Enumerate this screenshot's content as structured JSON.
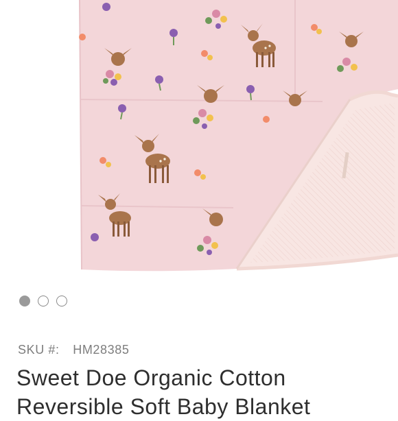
{
  "product": {
    "image_alt": "Pink fawn print quilted baby blanket with corner folded over",
    "sku_label": "SKU #:",
    "sku_value": "HM28385",
    "title": "Sweet Doe Organic Cotton Reversible Soft Baby Blanket"
  },
  "carousel": {
    "slides": 3,
    "active_index": 0
  },
  "colors": {
    "blanket_pink": "#f3d6d9",
    "reverse_pink": "#f8e6e3",
    "fawn_brown": "#9b6a45",
    "dot_active": "#9a9a9a",
    "title_text": "#2e2e2e",
    "sku_text": "#7d7d7d"
  }
}
